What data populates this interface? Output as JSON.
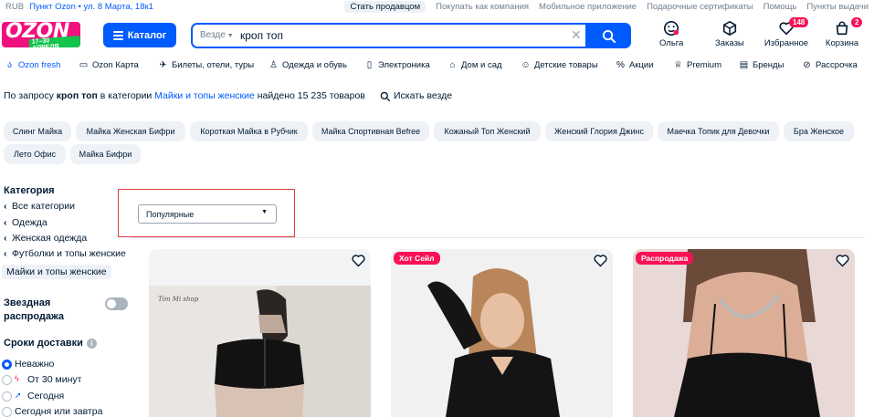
{
  "topbar": {
    "currency": "RUB",
    "location": "Пункт Ozon • ул. 8 Марта, 18к1",
    "links": [
      "Стать продавцом",
      "Покупать как компания",
      "Мобильное приложение",
      "Подарочные сертификаты",
      "Помощь",
      "Пункты выдачи"
    ]
  },
  "header": {
    "logo_text": "OZON",
    "logo_promo": "17–30 АПРЕЛЯ",
    "catalog_label": "Каталог",
    "search_scope": "Везде",
    "search_query": "кроп топ",
    "account_label": "Ольга",
    "orders_label": "Заказы",
    "favorites_label": "Избранное",
    "favorites_count": "148",
    "cart_label": "Корзина",
    "cart_count": "2"
  },
  "nav": {
    "items": [
      {
        "icon": "ozon-fresh-icon",
        "label": "Ozon fresh"
      },
      {
        "icon": "card-icon",
        "label": "Ozon Карта"
      },
      {
        "icon": "plane-icon",
        "label": "Билеты, отели, туры"
      },
      {
        "icon": "clothes-icon",
        "label": "Одежда и обувь"
      },
      {
        "icon": "phone-icon",
        "label": "Электроника"
      },
      {
        "icon": "home-icon",
        "label": "Дом и сад"
      },
      {
        "icon": "kids-icon",
        "label": "Детские товары"
      },
      {
        "icon": "percent-icon",
        "label": "Акции"
      },
      {
        "icon": "crown-icon",
        "label": "Premium"
      },
      {
        "icon": "brands-icon",
        "label": "Бренды"
      },
      {
        "icon": "installment-icon",
        "label": "Рассрочка"
      }
    ]
  },
  "results": {
    "prefix": "По запросу",
    "query": "кроп топ",
    "middle": "в категории",
    "category": "Майки и топы женские",
    "suffix": "найдено 15 235 товаров",
    "search_everywhere": "Искать везде"
  },
  "chips": [
    "Слинг Майка",
    "Майка Женская Бифри",
    "Короткая Майка в Рубчик",
    "Майка Спортивная Befree",
    "Кожаный Топ Женский",
    "Женский Глория Джинс",
    "Маечка Топик для Девочки",
    "Бра Женское",
    "Лето Офис",
    "Майка Бифри"
  ],
  "sort": {
    "selected": "Популярные"
  },
  "sidebar": {
    "category_title": "Категория",
    "category_path": [
      "Все категории",
      "Одежда",
      "Женская одежда",
      "Футболки и топы женские"
    ],
    "category_selected": "Майки и топы женские",
    "star_sale_line1": "Звездная",
    "star_sale_line2": "распродажа",
    "delivery_title": "Сроки доставки",
    "delivery_options": [
      {
        "label": "Неважно",
        "selected": true
      },
      {
        "label": "От 30 минут",
        "selected": false
      },
      {
        "label": "Сегодня",
        "selected": false
      },
      {
        "label": "Сегодня или завтра",
        "selected": false
      }
    ]
  },
  "products": [
    {
      "tag": ""
    },
    {
      "tag": "Хот Сейл"
    },
    {
      "tag": "Распродажа"
    }
  ]
}
